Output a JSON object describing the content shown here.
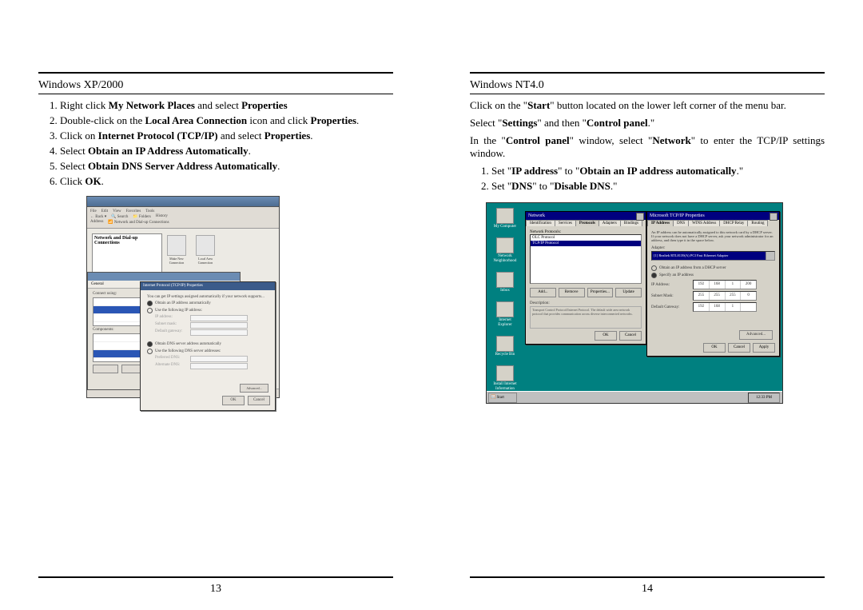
{
  "left": {
    "heading": "Windows XP/2000",
    "steps": {
      "s1a": "Right click ",
      "s1b": "My Network Places",
      "s1c": " and select ",
      "s1d": "Properties",
      "s2a": "Double-click on the ",
      "s2b": "Local Area Connection",
      "s2c": " icon and click ",
      "s2d": "Properties",
      "s2e": ".",
      "s3a": "Click on ",
      "s3b": "Internet Protocol (TCP/IP)",
      "s3c": " and select ",
      "s3d": "Properties",
      "s3e": ".",
      "s4a": "Select ",
      "s4b": "Obtain an IP Address Automatically",
      "s4c": ".",
      "s5a": "Select ",
      "s5b": "Obtain DNS Server Address Automatically",
      "s5c": ".",
      "s6a": "Click ",
      "s6b": "OK",
      "s6c": "."
    },
    "shot": {
      "pane_title": "Network and Dial-up Connections",
      "icon1": "Make New Connection",
      "icon2": "Local Area Connection",
      "props2_title": "Internet Protocol (TCP/IP) Properties",
      "radio_auto_ip": "Obtain an IP address automatically",
      "radio_use_ip": "Use the following IP address:",
      "radio_auto_dns": "Obtain DNS server address automatically",
      "radio_use_dns": "Use the following DNS server addresses:",
      "f_ip": "IP address:",
      "f_mask": "Subnet mask:",
      "f_gw": "Default gateway:",
      "btn_adv": "Advanced...",
      "btn_ok": "OK",
      "btn_cancel": "Cancel"
    },
    "pagenum": "13"
  },
  "right": {
    "heading": "Windows NT4.0",
    "p1a": "Click on the \"",
    "p1b": "Start",
    "p1c": "\" button located on the lower left corner of the menu bar.",
    "p2a": "Select \"",
    "p2b": "Settings",
    "p2c": "\" and then \"",
    "p2d": "Control panel",
    "p2e": ".\"",
    "p3a": "In the \"",
    "p3b": "Control panel",
    "p3c": "\" window, select \"",
    "p3d": "Network",
    "p3e": "\" to enter the TCP/IP settings window.",
    "s1a": "Set \"",
    "s1b": "IP address",
    "s1c": "\" to \"",
    "s1d": "Obtain an IP address automatically",
    "s1e": ".\"",
    "s2a": "Set \"",
    "s2b": "DNS",
    "s2c": "\" to \"",
    "s2d": "Disable DNS",
    "s2e": ".\"",
    "shot": {
      "desk": {
        "mycomp": "My Computer",
        "nethood": "Network Neighborhood",
        "inbox": "Inbox",
        "ie": "Internet Explorer",
        "recycle": "Recycle Bin",
        "setup": "Install Internet Information"
      },
      "nw": {
        "title": "Network",
        "tab_id": "Identification",
        "tab_sv": "Services",
        "tab_pr": "Protocols",
        "tab_ad": "Adapters",
        "tab_bn": "Bindings",
        "grp": "Network Protocols:",
        "row1": "OLC Protocol",
        "row2": "TCP/IP Protocol",
        "b_add": "Add...",
        "b_rem": "Remove",
        "b_prop": "Properties...",
        "b_upd": "Update",
        "desc_l": "Description:",
        "desc_t": "Transport Control Protocol/Internet Protocol. The default wide area network protocol that provides communication across diverse interconnected networks.",
        "ok": "OK",
        "cancel": "Cancel"
      },
      "tcp": {
        "title": "Microsoft TCP/IP Properties",
        "tab_ip": "IP Address",
        "tab_dns": "DNS",
        "tab_wins": "WINS Address",
        "tab_dhcp": "DHCP Relay",
        "tab_rt": "Routing",
        "note": "An IP address can be automatically assigned to this network card by a DHCP server. If your network does not have a DHCP server, ask your network administrator for an address, and then type it in the space below.",
        "adapter_l": "Adapter:",
        "adapter_v": "[1] Realtek RTL8139(A) PCI Fast Ethernet Adapter",
        "r_auto": "Obtain an IP address from a DHCP server",
        "r_spec": "Specify an IP address",
        "f_ip": "IP Address:",
        "f_mask": "Subnet Mask:",
        "f_gw": "Default Gateway:",
        "ip": [
          "192",
          "168",
          "1",
          "200"
        ],
        "mask": [
          "255",
          "255",
          "255",
          "0"
        ],
        "gw": [
          "192",
          "168",
          "1",
          ""
        ],
        "adv": "Advanced...",
        "ok": "OK",
        "cancel": "Cancel",
        "apply": "Apply"
      },
      "taskbar": {
        "start": "Start",
        "clock": "12:33 PM"
      }
    },
    "pagenum": "14"
  }
}
